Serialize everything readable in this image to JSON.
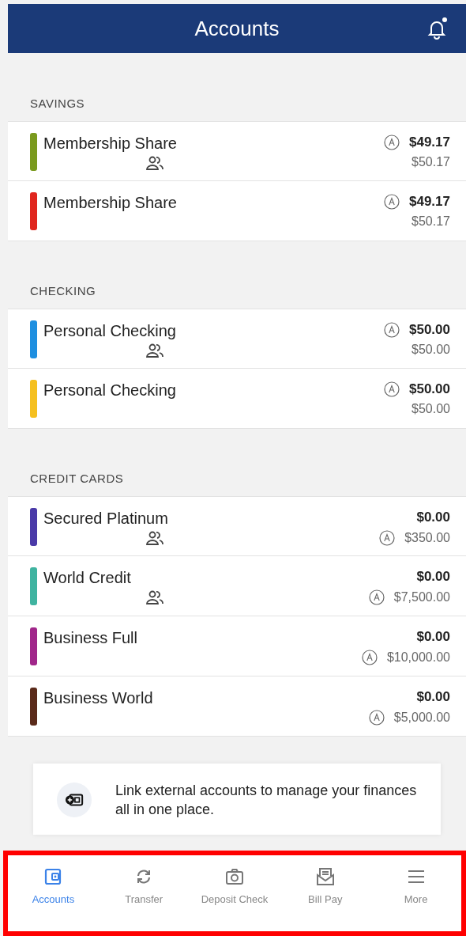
{
  "header": {
    "title": "Accounts",
    "notification_dot": true
  },
  "sections": [
    {
      "title": "SAVINGS",
      "accounts": [
        {
          "kind": "deposit",
          "name": "Membership Share",
          "color": "#7a9a1e",
          "joint": true,
          "balance": "$49.17",
          "secondary": "$50.17"
        },
        {
          "kind": "deposit",
          "name": "Membership Share",
          "color": "#e0261e",
          "joint": false,
          "balance": "$49.17",
          "secondary": "$50.17"
        }
      ]
    },
    {
      "title": "CHECKING",
      "accounts": [
        {
          "kind": "deposit",
          "name": "Personal Checking",
          "color": "#1e8fe0",
          "joint": true,
          "balance": "$50.00",
          "secondary": "$50.00"
        },
        {
          "kind": "deposit",
          "name": "Personal Checking",
          "color": "#f5c020",
          "joint": false,
          "balance": "$50.00",
          "secondary": "$50.00"
        }
      ]
    },
    {
      "title": "CREDIT CARDS",
      "accounts": [
        {
          "kind": "credit",
          "name": "Secured Platinum",
          "color": "#4a3aa8",
          "joint": true,
          "balance": "$0.00",
          "secondary": "$350.00"
        },
        {
          "kind": "credit",
          "name": "World Credit",
          "color": "#3fb3a0",
          "joint": true,
          "balance": "$0.00",
          "secondary": "$7,500.00"
        },
        {
          "kind": "credit",
          "name": "Business Full",
          "color": "#a0268a",
          "joint": false,
          "balance": "$0.00",
          "secondary": "$10,000.00"
        },
        {
          "kind": "credit",
          "name": "Business World",
          "color": "#5a2a1a",
          "joint": false,
          "balance": "$0.00",
          "secondary": "$5,000.00"
        }
      ]
    }
  ],
  "link_card": {
    "text": "Link external accounts to manage your finances all in one place."
  },
  "tab_bar": {
    "highlighted": true,
    "tabs": [
      {
        "kind": "wallet",
        "label": "Accounts",
        "selected": true
      },
      {
        "kind": "transfer",
        "label": "Transfer",
        "selected": false
      },
      {
        "kind": "camera",
        "label": "Deposit Check",
        "selected": false
      },
      {
        "kind": "bill",
        "label": "Bill Pay",
        "selected": false
      },
      {
        "kind": "menu",
        "label": "More",
        "selected": false
      }
    ]
  }
}
